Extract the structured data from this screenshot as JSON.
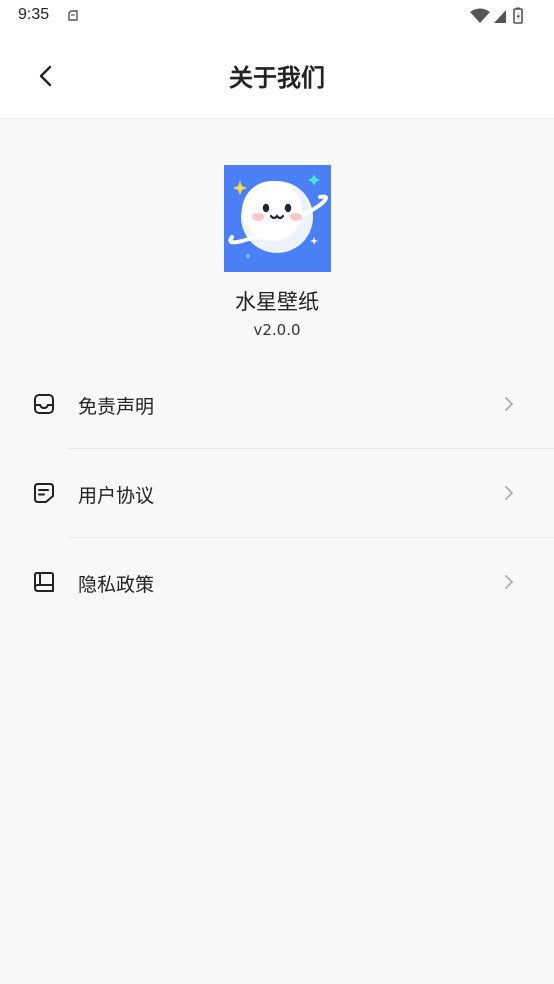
{
  "status_bar": {
    "time": "9:35",
    "icons": [
      "notification-icon",
      "wifi-icon",
      "signal-icon",
      "battery-icon"
    ]
  },
  "header": {
    "title": "关于我们",
    "back_icon": "chevron-left-icon"
  },
  "app": {
    "name": "水星壁纸",
    "version": "v2.0.0",
    "icon": "planet-face-icon",
    "icon_color": "#4b7ff5"
  },
  "menu": {
    "items": [
      {
        "label": "免责声明",
        "icon": "tray-icon"
      },
      {
        "label": "用户协议",
        "icon": "document-icon"
      },
      {
        "label": "隐私政策",
        "icon": "book-icon"
      }
    ]
  },
  "colors": {
    "background": "#f8f8f8",
    "surface": "#ffffff",
    "divider": "#e6e6e6",
    "chevron": "#b5b5b5"
  }
}
